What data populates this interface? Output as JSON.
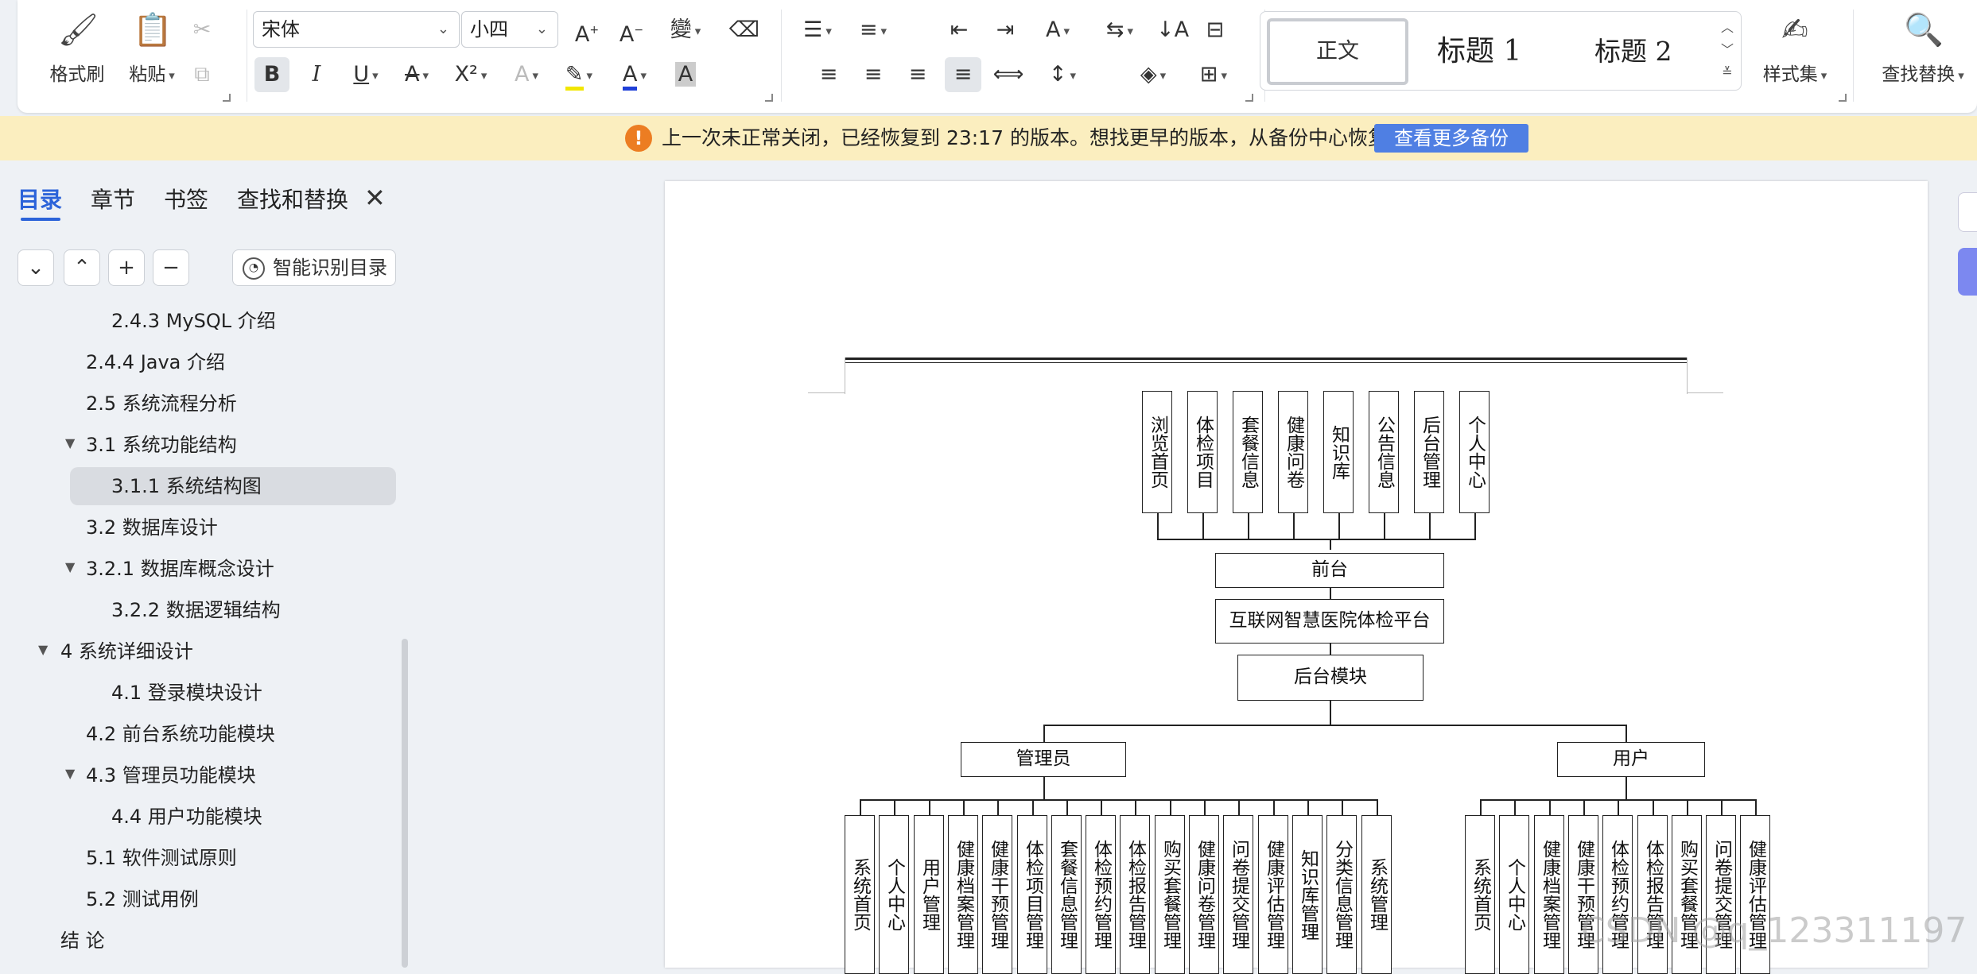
{
  "ribbon": {
    "format_painter": "格式刷",
    "paste": "粘贴",
    "font_name": "宋体",
    "font_size": "小四",
    "styles": {
      "normal": "正文",
      "heading1": "标题 1",
      "heading2": "标题 2"
    },
    "style_set": "样式集",
    "find_replace": "查找替换"
  },
  "notification": {
    "text": "上一次未正常关闭，已经恢复到 23:17 的版本。想找更早的版本，从备份中心恢复",
    "button": "查看更多备份"
  },
  "sidebar": {
    "tabs": [
      "目录",
      "章节",
      "书签",
      "查找和替换"
    ],
    "smart_toc": "智能识别目录",
    "toc": [
      "2.4.3 MySQL 介绍",
      "2.4.4 Java 介绍",
      "2.5 系统流程分析",
      "3.1 系统功能结构",
      "3.1.1 系统结构图",
      "3.2 数据库设计",
      "3.2.1  数据库概念设计",
      "3.2.2 数据逻辑结构",
      "4 系统详细设计",
      "4.1 登录模块设计",
      "4.2  前台系统功能模块",
      "4.3 管理员功能模块",
      "4.4  用户功能模块",
      "5.1 软件测试原则",
      "5.2 测试用例",
      "结  论"
    ]
  },
  "diagram": {
    "front_modules": [
      "浏览首页",
      "体检项目",
      "套餐信息",
      "健康问卷",
      "知识库",
      "公告信息",
      "后台管理",
      "个人中心"
    ],
    "front": "前台",
    "platform": "互联网智慧医院体检平台",
    "backend": "后台模块",
    "admin": "管理员",
    "user": "用户",
    "admin_modules": [
      "系统首页",
      "个人中心",
      "用户管理",
      "健康档案管理",
      "健康干预管理",
      "体检项目管理",
      "套餐信息管理",
      "体检预约管理",
      "体检报告管理",
      "购买套餐管理",
      "健康问卷管理",
      "问卷提交管理",
      "健康评估管理",
      "知识库管理",
      "分类信息管理",
      "系统管理"
    ],
    "user_modules": [
      "系统首页",
      "个人中心",
      "健康档案管理",
      "健康干预管理",
      "体检预约管理",
      "体检报告管理",
      "购买套餐管理",
      "问卷提交管理",
      "健康评估管理"
    ]
  },
  "watermark": "CSDN @q_123311197"
}
